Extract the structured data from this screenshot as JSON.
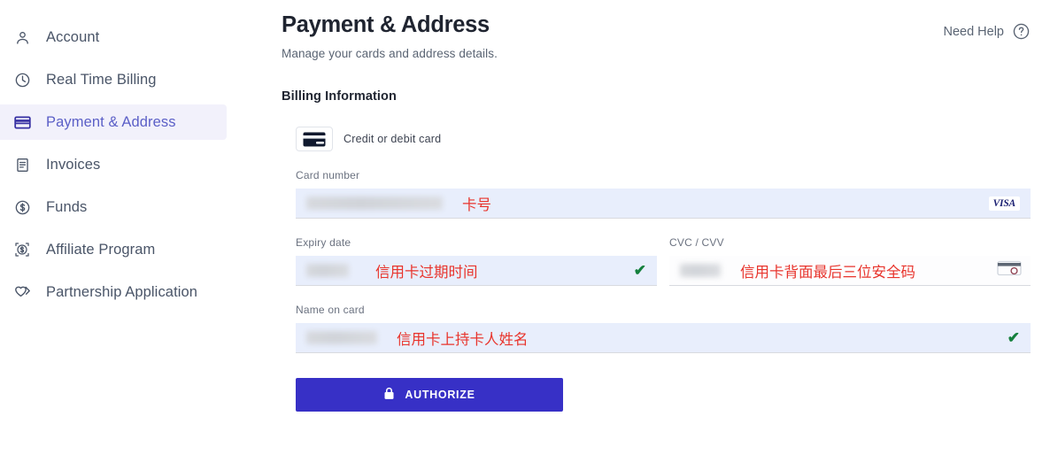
{
  "sidebar": {
    "items": [
      {
        "label": "Account",
        "icon": "user-icon",
        "active": false
      },
      {
        "label": "Real Time Billing",
        "icon": "clock-icon",
        "active": false
      },
      {
        "label": "Payment & Address",
        "icon": "credit-card-icon",
        "active": true
      },
      {
        "label": "Invoices",
        "icon": "invoice-icon",
        "active": false
      },
      {
        "label": "Funds",
        "icon": "dollar-circle-icon",
        "active": false
      },
      {
        "label": "Affiliate Program",
        "icon": "affiliate-icon",
        "active": false
      },
      {
        "label": "Partnership Application",
        "icon": "handshake-icon",
        "active": false
      }
    ]
  },
  "header": {
    "title": "Payment & Address",
    "subtitle": "Manage your cards and address details.",
    "need_help": "Need Help",
    "help_icon": "question-circle-icon"
  },
  "billing": {
    "section_title": "Billing Information",
    "card_type_label": "Credit or debit card",
    "card_type_icon": "credit-card-icon",
    "fields": {
      "card_number": {
        "label": "Card number",
        "value": "",
        "annotation": "卡号",
        "brand": "VISA",
        "valid": false
      },
      "expiry": {
        "label": "Expiry date",
        "value": "",
        "annotation": "信用卡过期时间",
        "valid": true,
        "check": "✔"
      },
      "cvc": {
        "label": "CVC / CVV",
        "value": "",
        "annotation": "信用卡背面最后三位安全码",
        "icon": "card-back-cvc-icon",
        "valid": false
      },
      "name_on_card": {
        "label": "Name on card",
        "value": "",
        "annotation": "信用卡上持卡人姓名",
        "valid": true,
        "check": "✔"
      }
    },
    "authorize_button": {
      "label": "AUTHORIZE",
      "icon": "lock-icon"
    }
  },
  "colors": {
    "accent": "#3730c6",
    "active_nav_bg": "#f2f1fb",
    "active_nav_text": "#5b5fc7",
    "field_filled_bg": "#e8eefc",
    "annotation_red": "#e8342c",
    "valid_green": "#15803d",
    "visa_blue": "#1a1f71"
  }
}
